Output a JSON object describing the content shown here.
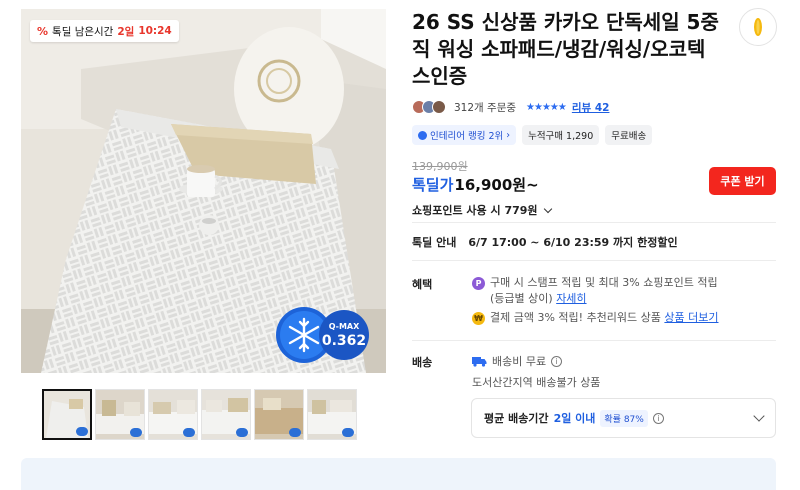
{
  "gallery": {
    "timer_prefix": "톡딜 남은시간",
    "timer_days": "2일",
    "timer_clock": "10:24",
    "badge_top": "Q-MAX",
    "badge_value": "0.362",
    "thumbnail_count": 6
  },
  "product": {
    "title": "26 SS 신상품 카카오 단독세일 5중직 워싱 소파패드/냉감/워싱/오코텍스인증",
    "order_count": "312개 주문중",
    "rating_stars": "★★★★★",
    "review_label": "리뷰 42",
    "chips": [
      "인테리어 랭킹 2위",
      "누적구매 1,290",
      "무료배송"
    ],
    "original_price": "139,900원",
    "sale_label": "톡딜가",
    "sale_price": "16,900원~",
    "coupon_label": "쿠폰 받기",
    "points_label": "쇼핑포인트 사용 시 779원"
  },
  "deal": {
    "label": "톡딜 안내",
    "period": "6/7 17:00 ~ 6/10 23:59 까지 한정할인"
  },
  "benefits": {
    "label": "혜택",
    "line1": "구매 시 스탬프 적립 및 최대 3% 쇼핑포인트 적립",
    "line1_sub": "(등급별 상이)",
    "line1_link": "자세히",
    "line2": "결제 금액 3% 적립! 추천리워드 상품",
    "line2_link": "상품 더보기"
  },
  "shipping": {
    "label": "배송",
    "fee": "배송비 무료",
    "restriction": "도서산간지역 배송불가 상품",
    "avg_label": "평균 배송기간",
    "avg_value": "2일 이내",
    "probability": "확률 87%"
  },
  "colors": {
    "accent_blue": "#1f5fe0",
    "coupon_red": "#f3261e",
    "timer_red": "#e8362c"
  },
  "icons": {
    "share": "share-icon",
    "stamp": "point-icon",
    "reward": "reward-icon",
    "truck": "truck-icon",
    "info": "info-icon"
  }
}
